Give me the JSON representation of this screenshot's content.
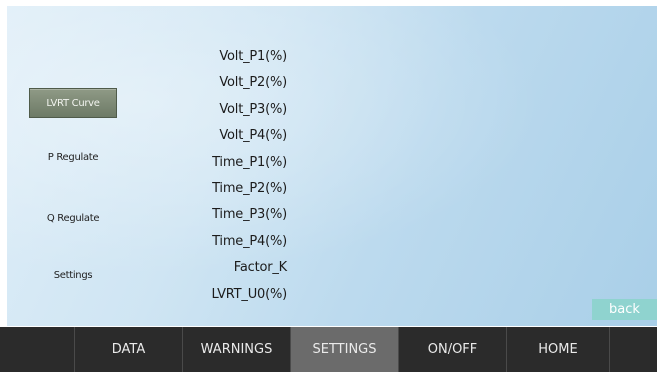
{
  "sidebar": {
    "items": [
      {
        "label": "LVRT Curve",
        "active": true
      },
      {
        "label": "P Regulate",
        "active": false
      },
      {
        "label": "Q Regulate",
        "active": false
      },
      {
        "label": "Settings",
        "active": false
      }
    ]
  },
  "parameters": [
    "Volt_P1(%)",
    "Volt_P2(%)",
    "Volt_P3(%)",
    "Volt_P4(%)",
    "Time_P1(%)",
    "Time_P2(%)",
    "Time_P3(%)",
    "Time_P4(%)",
    "Factor_K",
    "LVRT_U0(%)"
  ],
  "back_button": {
    "label": "back"
  },
  "nav": {
    "tabs": [
      {
        "label": "DATA",
        "active": false
      },
      {
        "label": "WARNINGS",
        "active": false
      },
      {
        "label": "SETTINGS",
        "active": true
      },
      {
        "label": "ON/OFF",
        "active": false
      },
      {
        "label": "HOME",
        "active": false
      }
    ]
  },
  "colors": {
    "panel_bg": "#c4dff0",
    "active_side_button": "#7b8873",
    "back_button": "#8fd3cf",
    "nav_bg": "#2b2b2b",
    "nav_active": "#6b6b6b"
  }
}
